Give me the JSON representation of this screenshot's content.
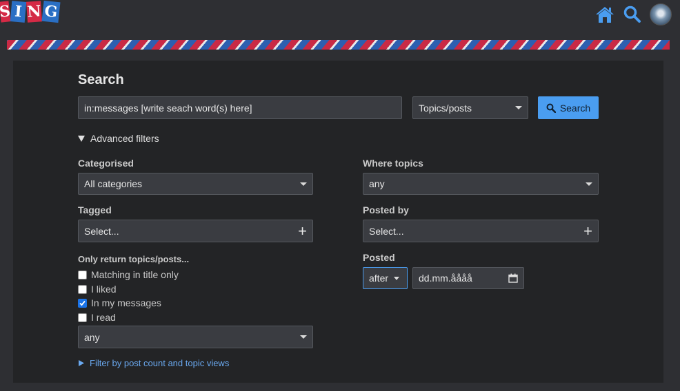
{
  "header": {
    "logo_letters": [
      "S",
      "I",
      "N",
      "G"
    ],
    "icons": [
      "home-icon",
      "search-icon",
      "avatar"
    ]
  },
  "colors": {
    "accent": "#4a9df0",
    "red": "#c92a45",
    "blue": "#2d5fb0"
  },
  "search": {
    "title": "Search",
    "query_value": "in:messages [write seach word(s) here]",
    "type_selected": "Topics/posts",
    "button_label": "Search"
  },
  "advanced": {
    "toggle_label": "Advanced filters",
    "categorised_label": "Categorised",
    "categorised_value": "All categories",
    "tagged_label": "Tagged",
    "tagged_placeholder": "Select...",
    "where_topics_label": "Where topics",
    "where_topics_value": "any",
    "posted_by_label": "Posted by",
    "posted_by_placeholder": "Select...",
    "posted_label": "Posted",
    "posted_relation": "after",
    "posted_date_placeholder": "dd.mm.åååå",
    "only_return_label": "Only return topics/posts...",
    "checkboxes": [
      {
        "label": "Matching in title only",
        "checked": false
      },
      {
        "label": "I liked",
        "checked": false
      },
      {
        "label": "In my messages",
        "checked": true
      },
      {
        "label": "I read",
        "checked": false
      }
    ],
    "status_value": "any",
    "filter_link": "Filter by post count and topic views"
  }
}
